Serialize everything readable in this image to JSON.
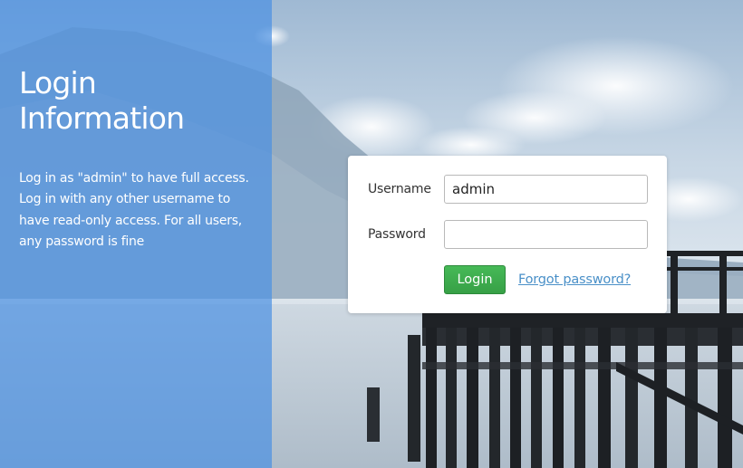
{
  "info": {
    "title_line1": "Login",
    "title_line2": "Information",
    "description": "Log in as \"admin\" to have full access. Log in with any other username to have read-only access. For all users, any password is fine"
  },
  "form": {
    "username_label": "Username",
    "username_value": "admin",
    "password_label": "Password",
    "password_value": "",
    "login_label": "Login",
    "forgot_label": "Forgot password?"
  },
  "colors": {
    "panel_blue": "#4a90e2",
    "login_green": "#3aa94a",
    "link_blue": "#4a90c8"
  }
}
